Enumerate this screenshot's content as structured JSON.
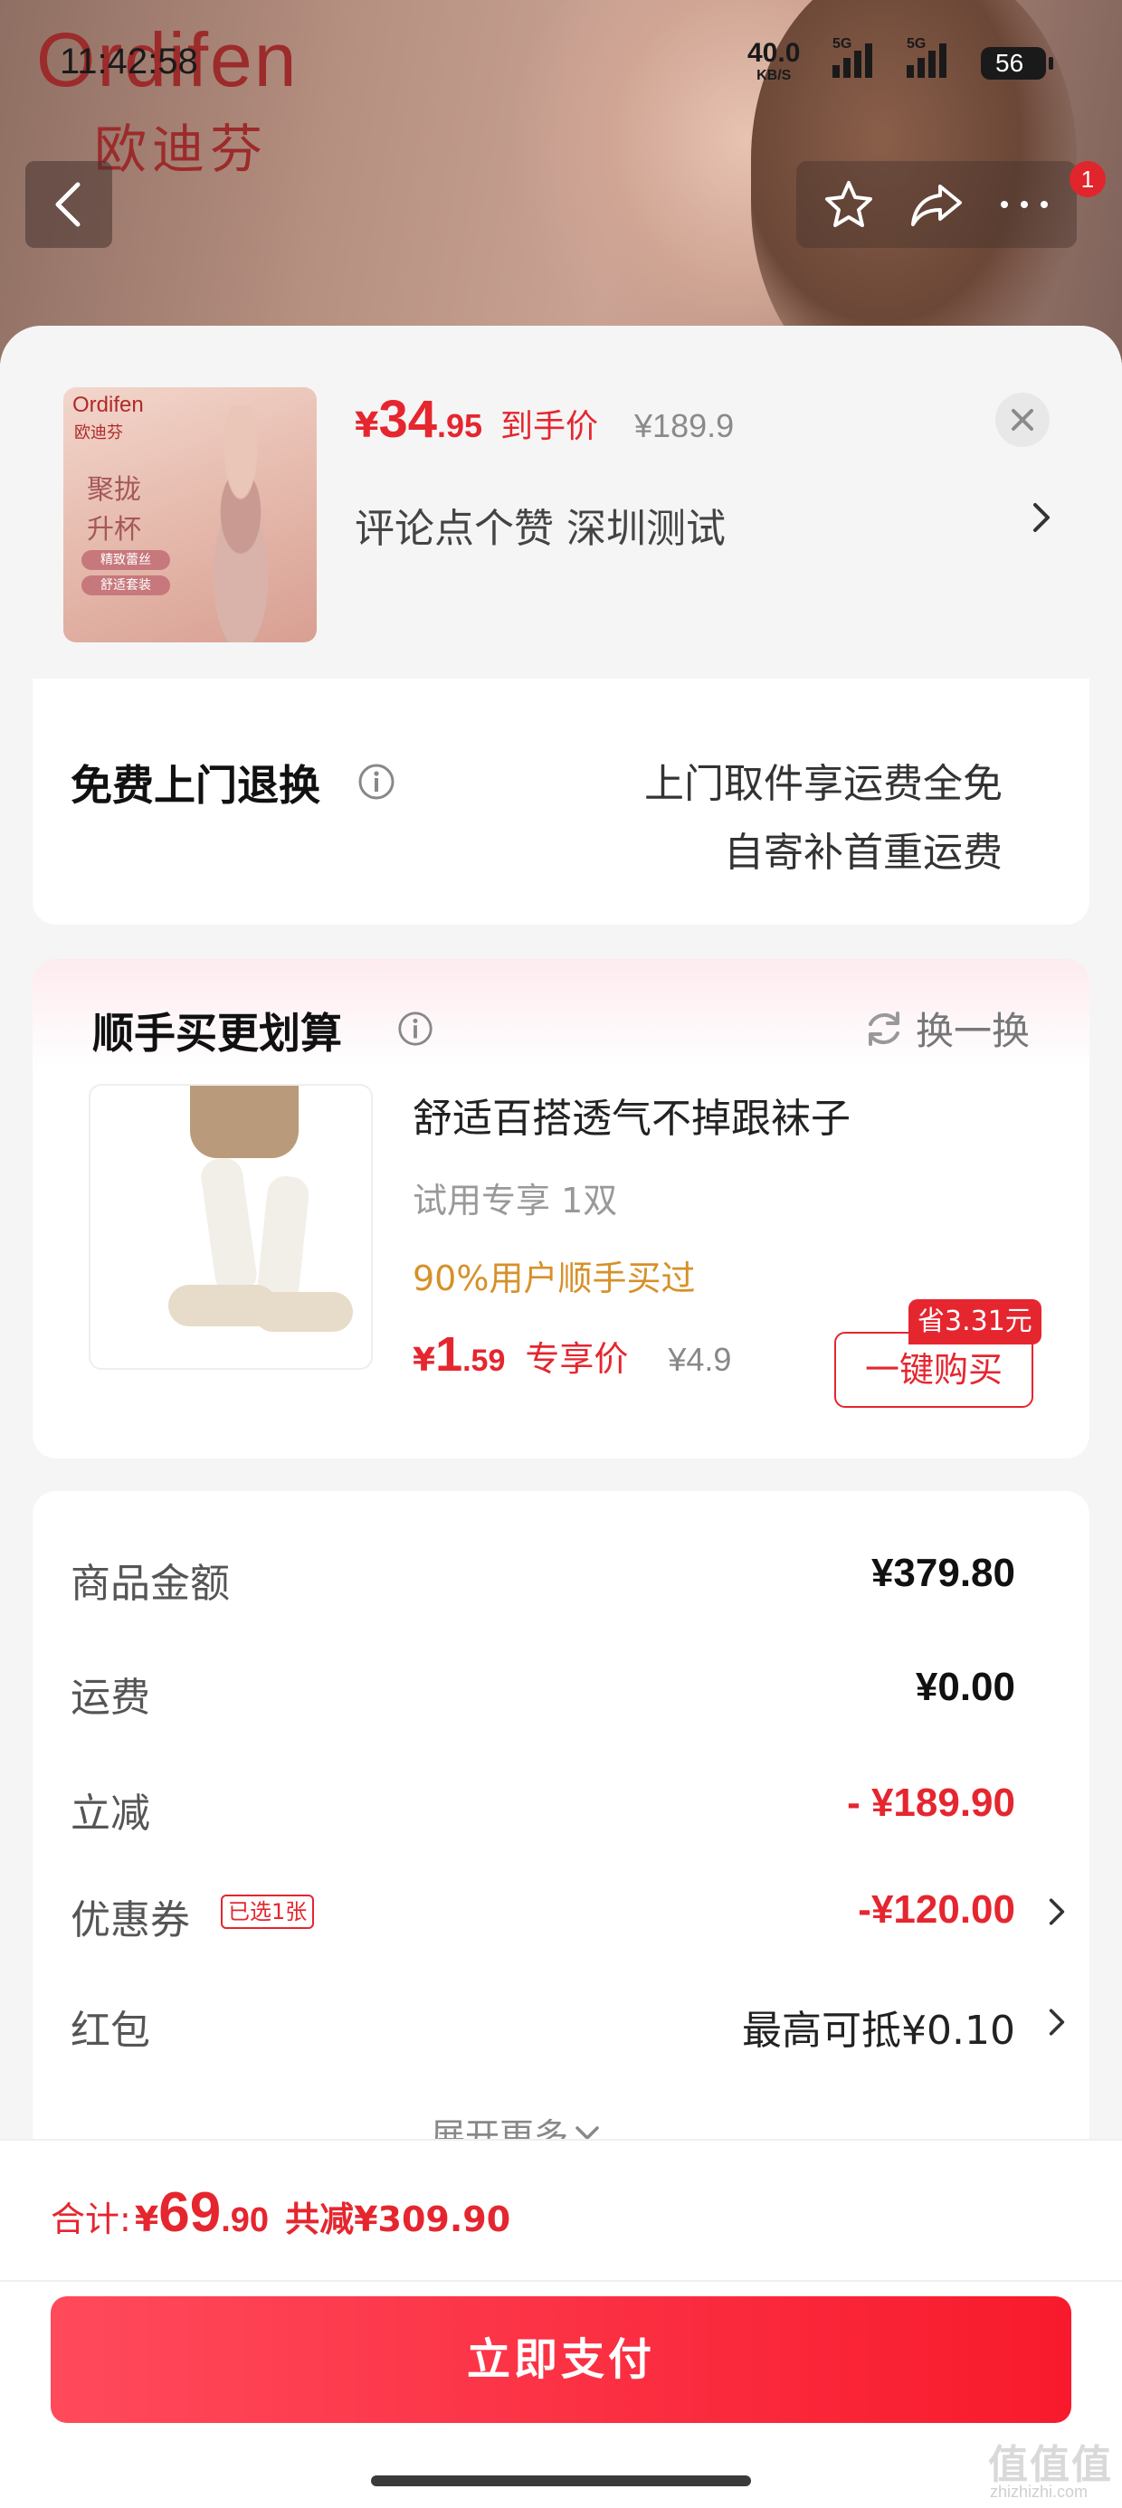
{
  "status_bar": {
    "time": "11:42:58",
    "net_speed": "40.0",
    "net_unit": "KB/S",
    "sig1_label": "5G",
    "sig2_label": "5G",
    "battery": "56"
  },
  "banner": {
    "brand_en": "Ordifen",
    "brand_cn": "欧迪芬",
    "cart_badge": "1"
  },
  "product": {
    "thumb_brand_en": "Ordifen",
    "thumb_brand_cn": "欧迪芬",
    "thumb_slogan": "聚拢 升杯",
    "thumb_chip1": "精致蕾丝",
    "thumb_chip2": "舒适套装",
    "price_currency": "¥",
    "price_int": "34",
    "price_dec": ".95",
    "price_label": "到手价",
    "original_price": "¥189.9",
    "spec": "评论点个赞  深圳测试"
  },
  "return_card": {
    "title": "免费上门退换",
    "line1": "上门取件享运费全免",
    "line2": "自寄补首重运费"
  },
  "addon_card": {
    "title": "顺手买更划算",
    "swap_label": "换一换",
    "name": "舒适百搭透气不掉跟袜子",
    "sub": "试用专享 1双",
    "hint": "90%用户顺手买过",
    "price_currency": "¥",
    "price_int": "1",
    "price_dec": ".59",
    "price_label": "专享价",
    "original_price": "¥4.9",
    "save_tag": "省3.31元",
    "buy_label": "一键购买"
  },
  "summary": {
    "rows": [
      {
        "label": "商品金额",
        "value": "¥379.80"
      },
      {
        "label": "运费",
        "value": "¥0.00"
      },
      {
        "label": "立减",
        "value": "- ¥189.90"
      },
      {
        "label": "优惠券",
        "tag": "已选1张",
        "value": "-¥120.00"
      },
      {
        "label": "红包",
        "value": "最高可抵¥0.10"
      }
    ],
    "expand_label": "展开更多"
  },
  "bottom": {
    "total_label": "合计:",
    "currency": "¥",
    "total_int": "69",
    "total_dec": ".90",
    "saved": "共减¥309.90",
    "pay_label": "立即支付",
    "watermark": "值值值",
    "watermark_sub": "zhizhizhi.com"
  },
  "colors": {
    "accent_red": "#e5262f",
    "hint_orange": "#d6912a",
    "pay_button": "#fb2f42"
  },
  "icons": [
    "back-arrow-icon",
    "star-icon",
    "share-icon",
    "more-icon",
    "close-icon",
    "chevron-right-icon",
    "info-icon",
    "refresh-icon",
    "chevron-down-icon"
  ]
}
